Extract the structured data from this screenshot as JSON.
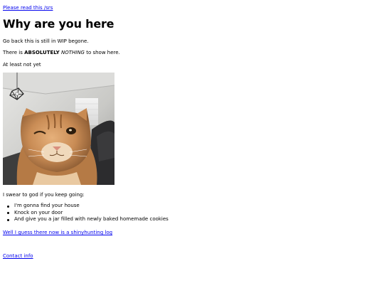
{
  "top_link": {
    "text": "Please read this /srs"
  },
  "heading": "Why are you here",
  "paragraphs": {
    "go_back": "Go back this is still in WIP begone.",
    "nothing_prefix": "There is ",
    "nothing_bold": "ABSOLUTELY",
    "nothing_space": " ",
    "nothing_italic": "NOTHING",
    "nothing_suffix": " to show here.",
    "not_yet": "At least not yet",
    "swear": "I swear to god if you keep going:"
  },
  "image": {
    "alt": "cat"
  },
  "list": {
    "items": [
      "I'm gonna find your house",
      "Knock on your door",
      "And give you a jar filled with newly baked homemade cookies"
    ]
  },
  "links": {
    "shinyhunting": "Well I guess there now is a shinyhunting log",
    "contact": "Contact info"
  },
  "colors": {
    "link": "#0000ee",
    "text": "#000000",
    "background": "#ffffff"
  }
}
